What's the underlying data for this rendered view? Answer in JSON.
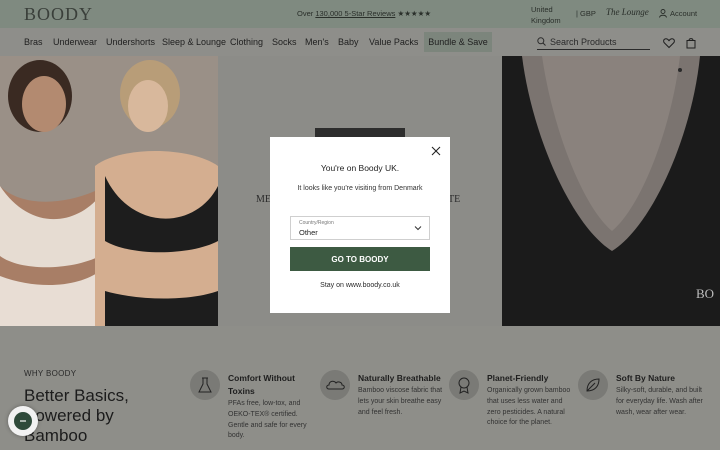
{
  "header": {
    "logo": "BOODY",
    "promo_prefix": "Over ",
    "promo_link": "130,000 5-Star Reviews",
    "promo_stars": " ★★★★★",
    "region": "United Kingdom",
    "currency": "| GBP",
    "lounge": "The Lounge",
    "account": "Account"
  },
  "nav": {
    "items": [
      "Bras",
      "Underwear",
      "Undershorts",
      "Sleep & Lounge",
      "Clothing",
      "Socks",
      "Men's",
      "Baby",
      "Value Packs"
    ],
    "bundle": "Bundle & Save",
    "search_placeholder": "Search Products"
  },
  "hero": {
    "mid_left": "ME",
    "mid_right": "TE",
    "right_logo": "BO"
  },
  "why": {
    "label": "WHY BOODY",
    "headline": "Better Basics, Powered by Bamboo",
    "features": [
      {
        "title": "Comfort Without Toxins",
        "desc": "PFAs free, low-tox, and OEKO-TEX® certified. Gentle and safe for every body.",
        "icon": "flask-icon"
      },
      {
        "title": "Naturally Breathable",
        "desc": "Bamboo viscose fabric that lets your skin breathe easy and feel fresh.",
        "icon": "cloud-icon"
      },
      {
        "title": "Planet-Friendly",
        "desc": "Organically grown bamboo that uses less water and zero pesticides. A natural choice for the planet.",
        "icon": "award-icon"
      },
      {
        "title": "Soft By Nature",
        "desc": "Silky-soft, durable, and built for everyday life. Wash after wash, wear after wear.",
        "icon": "leaf-icon"
      }
    ]
  },
  "modal": {
    "title": "You're on Boody UK.",
    "text": "It looks like you're visiting from Denmark",
    "select_label": "Country/Region",
    "select_value": "Other",
    "button": "GO TO BOODY",
    "stay": "Stay on www.boody.co.uk"
  },
  "colors": {
    "topbar": "#7f8a80",
    "button": "#3d5a42"
  }
}
